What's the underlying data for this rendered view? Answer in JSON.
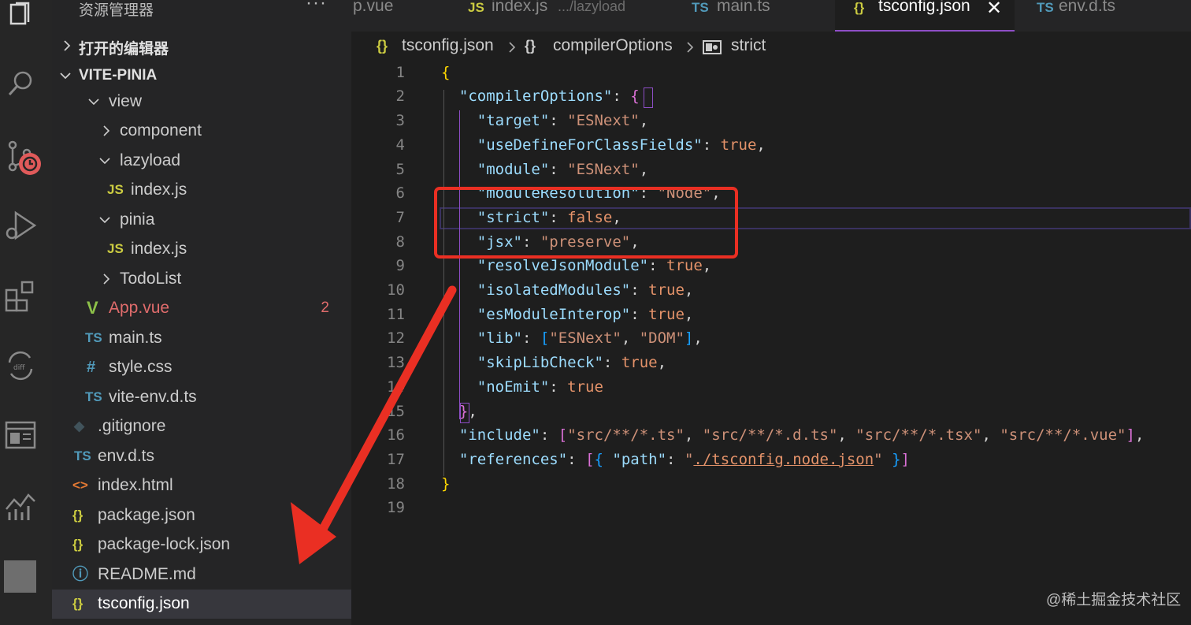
{
  "sidebar": {
    "header": "资源管理器",
    "more": "···",
    "open_editors": "打开的编辑器",
    "project": "VITE-PINIA",
    "items": [
      {
        "label": "view",
        "icon": "",
        "kind": "folder-open"
      },
      {
        "label": "component",
        "icon": "",
        "kind": "folder-closed"
      },
      {
        "label": "lazyload",
        "icon": "",
        "kind": "folder-open"
      },
      {
        "label": "index.js",
        "icon": "JS",
        "kind": "js"
      },
      {
        "label": "pinia",
        "icon": "",
        "kind": "folder-open"
      },
      {
        "label": "index.js",
        "icon": "JS",
        "kind": "js"
      },
      {
        "label": "TodoList",
        "icon": "",
        "kind": "folder-closed"
      },
      {
        "label": "App.vue",
        "icon": "V",
        "kind": "vue",
        "badge": "2"
      },
      {
        "label": "main.ts",
        "icon": "TS",
        "kind": "ts"
      },
      {
        "label": "style.css",
        "icon": "#",
        "kind": "css"
      },
      {
        "label": "vite-env.d.ts",
        "icon": "TS",
        "kind": "ts"
      },
      {
        "label": ".gitignore",
        "icon": "◆",
        "kind": "git"
      },
      {
        "label": "env.d.ts",
        "icon": "TS",
        "kind": "ts"
      },
      {
        "label": "index.html",
        "icon": "<>",
        "kind": "html"
      },
      {
        "label": "package.json",
        "icon": "{}",
        "kind": "json"
      },
      {
        "label": "package-lock.json",
        "icon": "{}",
        "kind": "json"
      },
      {
        "label": "README.md",
        "icon": "ⓘ",
        "kind": "info"
      },
      {
        "label": "tsconfig.json",
        "icon": "{}",
        "kind": "json"
      }
    ]
  },
  "tabs": [
    {
      "label": "p.vue",
      "icon": "",
      "desc": ""
    },
    {
      "label": "index.js",
      "icon": "JS",
      "desc": ".../lazyload"
    },
    {
      "label": "main.ts",
      "icon": "TS",
      "desc": ""
    },
    {
      "label": "tsconfig.json",
      "icon": "{}",
      "desc": "",
      "close": "✕"
    },
    {
      "label": "env.d.ts",
      "icon": "TS",
      "desc": ""
    }
  ],
  "breadcrumb": {
    "file": "tsconfig.json",
    "file_icon": "{}",
    "section": "compilerOptions",
    "section_icon": "{}",
    "leaf": "strict"
  },
  "line_numbers": [
    "1",
    "2",
    "3",
    "4",
    "5",
    "6",
    "7",
    "8",
    "9",
    "10",
    "11",
    "12",
    "13",
    "14",
    "15",
    "16",
    "17",
    "18",
    "19"
  ],
  "code": {
    "l2_key": "\"compilerOptions\"",
    "target_key": "\"target\"",
    "target_val": "\"ESNext\"",
    "udcf_key": "\"useDefineForClassFields\"",
    "udcf_val": "true",
    "module_key": "\"module\"",
    "module_val": "\"ESNext\"",
    "modres_key": "\"moduleResolution\"",
    "modres_val": "\"Node\"",
    "strict_key": "\"strict\"",
    "strict_val": "false",
    "jsx_key": "\"jsx\"",
    "jsx_val": "\"preserve\"",
    "rjm_key": "\"resolveJsonModule\"",
    "rjm_val": "true",
    "iso_key": "\"isolatedModules\"",
    "iso_val": "true",
    "esm_key": "\"esModuleInterop\"",
    "esm_val": "true",
    "lib_key": "\"lib\"",
    "lib_v1": "\"ESNext\"",
    "lib_v2": "\"DOM\"",
    "slc_key": "\"skipLibCheck\"",
    "slc_val": "true",
    "noemit_key": "\"noEmit\"",
    "noemit_val": "true",
    "include_key": "\"include\"",
    "inc1": "\"src/**/*.ts\"",
    "inc2": "\"src/**/*.d.ts\"",
    "inc3": "\"src/**/*.tsx\"",
    "inc4": "\"src/**/*.vue\"",
    "refs_key": "\"references\"",
    "path_key": "\"path\"",
    "path_val": "./tsconfig.node.json"
  },
  "colors": {
    "annotation_red": "#ea2f23",
    "active_tab_accent": "#8e4ec6",
    "js_icon": "#cbcb41",
    "ts_icon": "#519aba",
    "vue_icon": "#8dc149",
    "json_icon": "#cbcb41"
  },
  "watermark": "@稀土掘金技术社区"
}
